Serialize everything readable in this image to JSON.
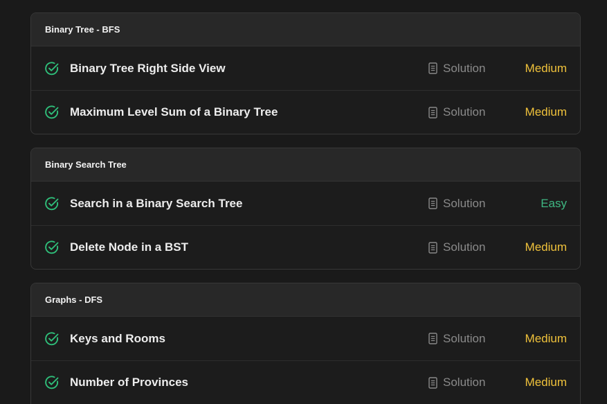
{
  "colors": {
    "medium": "#f0c23b",
    "easy": "#3fb883",
    "check": "#2fbf7a"
  },
  "groups": [
    {
      "title": "Binary Tree - BFS",
      "problems": [
        {
          "title": "Binary Tree Right Side View",
          "solution": "Solution",
          "difficulty": "Medium",
          "solved": true
        },
        {
          "title": "Maximum Level Sum of a Binary Tree",
          "solution": "Solution",
          "difficulty": "Medium",
          "solved": true
        }
      ]
    },
    {
      "title": "Binary Search Tree",
      "problems": [
        {
          "title": "Search in a Binary Search Tree",
          "solution": "Solution",
          "difficulty": "Easy",
          "solved": true
        },
        {
          "title": "Delete Node in a BST",
          "solution": "Solution",
          "difficulty": "Medium",
          "solved": true
        }
      ]
    },
    {
      "title": "Graphs - DFS",
      "problems": [
        {
          "title": "Keys and Rooms",
          "solution": "Solution",
          "difficulty": "Medium",
          "solved": true
        },
        {
          "title": "Number of Provinces",
          "solution": "Solution",
          "difficulty": "Medium",
          "solved": true
        }
      ]
    }
  ]
}
